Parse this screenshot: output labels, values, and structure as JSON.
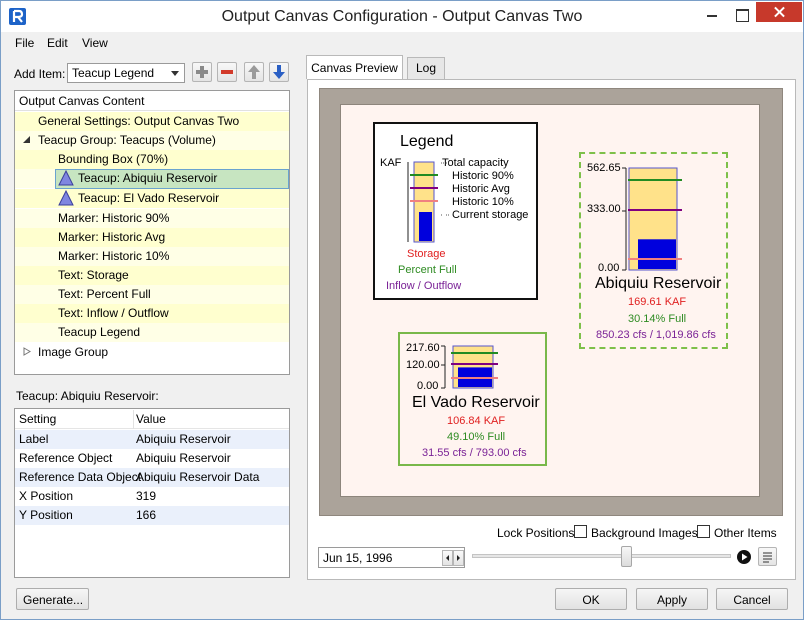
{
  "window": {
    "title": "Output Canvas Configuration - Output Canvas Two"
  },
  "menu": [
    "File",
    "Edit",
    "View"
  ],
  "add_item": {
    "label": "Add Item:",
    "selected": "Teacup Legend"
  },
  "tree": {
    "header": "Output Canvas Content",
    "items": [
      "General Settings: Output Canvas Two",
      "Teacup Group: Teacups (Volume)",
      "Bounding Box (70%)",
      "Teacup: Abiquiu Reservoir",
      "Teacup: El Vado Reservoir",
      "Marker: Historic 90%",
      "Marker: Historic Avg",
      "Marker: Historic 10%",
      "Text: Storage",
      "Text: Percent Full",
      "Text: Inflow / Outflow",
      "Teacup Legend",
      "Image Group"
    ]
  },
  "properties": {
    "title": "Teacup: Abiquiu Reservoir:",
    "col_setting": "Setting",
    "col_value": "Value",
    "rows": [
      {
        "setting": "Label",
        "value": "Abiquiu Reservoir"
      },
      {
        "setting": "Reference Object",
        "value": "Abiquiu Reservoir"
      },
      {
        "setting": "Reference Data Object",
        "value": "Abiquiu Reservoir Data"
      },
      {
        "setting": "X Position",
        "value": "319"
      },
      {
        "setting": "Y Position",
        "value": "166"
      }
    ]
  },
  "tabs": [
    "Canvas Preview",
    "Log"
  ],
  "legend": {
    "title": "Legend",
    "unit": "KAF",
    "entries": [
      "Total capacity",
      "Historic 90%",
      "Historic Avg",
      "Historic 10%",
      "Current storage"
    ],
    "storage": "Storage",
    "percent_full": "Percent Full",
    "flow": "Inflow / Outflow"
  },
  "abiquiu": {
    "name": "Abiquiu Reservoir",
    "ticks": [
      "562.65",
      "333.00",
      "0.00"
    ],
    "storage": "169.61 KAF",
    "percent": "30.14% Full",
    "flow": "850.23 cfs / 1,019.86 cfs",
    "fill_fraction": 0.3014
  },
  "elvado": {
    "name": "El Vado Reservoir",
    "ticks": [
      "217.60",
      "120.00",
      "0.00"
    ],
    "storage": "106.84 KAF",
    "percent": "49.10% Full",
    "flow": "31.55 cfs / 793.00 cfs",
    "fill_fraction": 0.491
  },
  "lock": {
    "label": "Lock Positions:",
    "background": "Background Images",
    "other": "Other Items"
  },
  "date": "Jun 15, 1996",
  "buttons": {
    "generate": "Generate...",
    "ok": "OK",
    "apply": "Apply",
    "cancel": "Cancel"
  },
  "colors": {
    "historic90": "#228b22",
    "historicAvg": "#800080",
    "historic10": "#f08080",
    "storage": "#0000dd",
    "cup": "#ffe28a"
  }
}
